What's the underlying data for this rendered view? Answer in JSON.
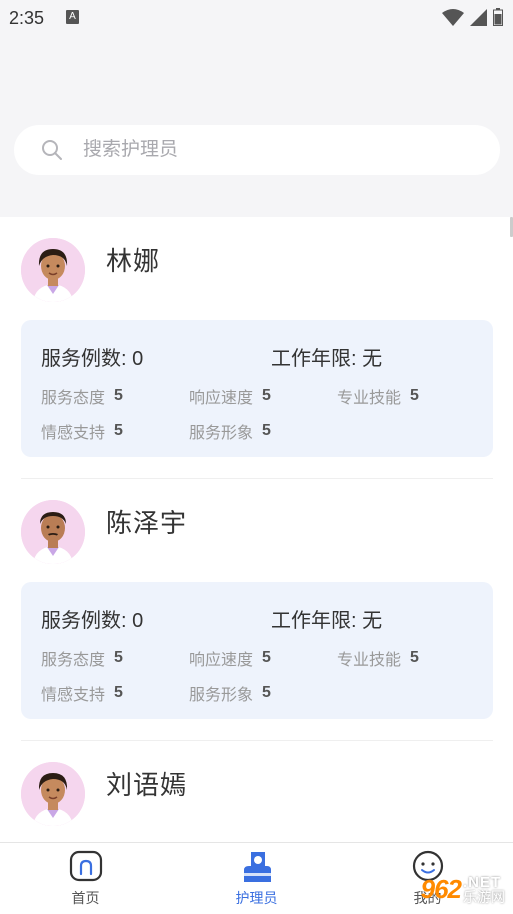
{
  "status_bar": {
    "time": "2:35",
    "notif_letter": "A"
  },
  "search": {
    "placeholder": "搜索护理员"
  },
  "stats_labels": {
    "service_count": "服务例数:",
    "work_years": "工作年限:",
    "attitude": "服务态度",
    "response": "响应速度",
    "skill": "专业技能",
    "support": "情感支持",
    "image": "服务形象"
  },
  "caregivers": [
    {
      "name": "林娜",
      "service_count": "0",
      "work_years": "无",
      "attitude": "5",
      "response": "5",
      "skill": "5",
      "support": "5",
      "image": "5",
      "avatar_icon": "female-caregiver-avatar"
    },
    {
      "name": "陈泽宇",
      "service_count": "0",
      "work_years": "无",
      "attitude": "5",
      "response": "5",
      "skill": "5",
      "support": "5",
      "image": "5",
      "avatar_icon": "male-caregiver-avatar"
    },
    {
      "name": "刘语嫣",
      "avatar_icon": "female-caregiver-avatar"
    }
  ],
  "bottom_nav": {
    "items": [
      {
        "label": "首页",
        "icon": "home-icon"
      },
      {
        "label": "护理员",
        "icon": "caregiver-icon",
        "active": true
      },
      {
        "label": "我的",
        "icon": "profile-icon"
      }
    ]
  },
  "watermark": {
    "num": "962",
    "net": ".NET",
    "cn": "乐游网"
  },
  "colors": {
    "accent": "#3a6fe0",
    "panel": "#eef3fc",
    "avatar_bg": "#f5d6ee",
    "top_bg": "#f5f5f7"
  }
}
